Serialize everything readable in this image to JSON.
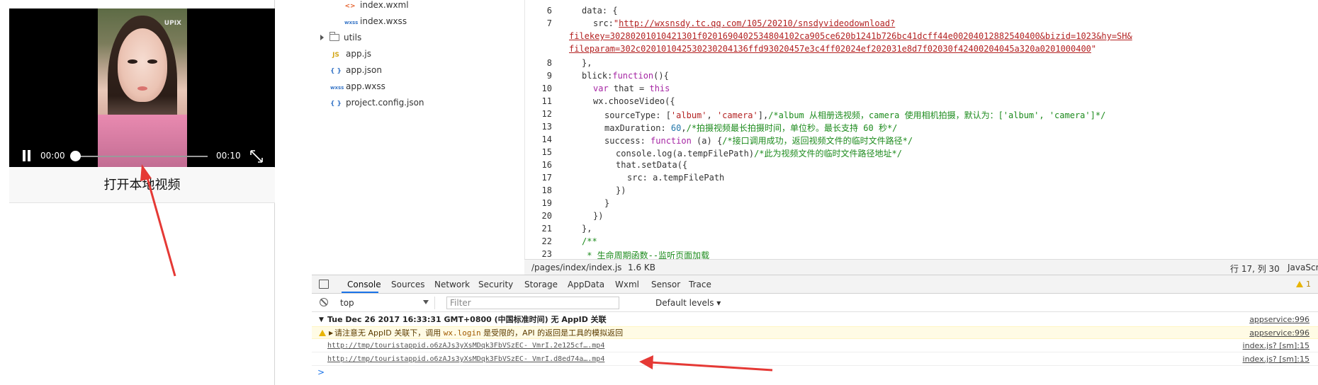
{
  "simulator": {
    "watermark": "UPIX",
    "video": {
      "current_time": "00:00",
      "total_time": "00:10",
      "progress": 0
    },
    "open_button_label": "打开本地视频"
  },
  "file_tree": [
    {
      "icon": "wxml-icon",
      "glyph": "<>",
      "label": "index.wxml"
    },
    {
      "icon": "wxss-icon",
      "glyph": "wxss",
      "label": "index.wxss"
    },
    {
      "icon": "folder-icon",
      "glyph": "",
      "label": "utils"
    },
    {
      "icon": "js-icon",
      "glyph": "JS",
      "label": "app.js"
    },
    {
      "icon": "json-icon",
      "glyph": "{ }",
      "label": "app.json"
    },
    {
      "icon": "wxss-icon",
      "glyph": "wxss",
      "label": "app.wxss"
    },
    {
      "icon": "json-icon",
      "glyph": "{ }",
      "label": "project.config.json"
    }
  ],
  "editor": {
    "line_numbers": [
      "6",
      "7",
      "8",
      "9",
      "10",
      "11",
      "12",
      "13",
      "14",
      "15",
      "16",
      "17",
      "18",
      "19",
      "20",
      "21",
      "22",
      "23"
    ],
    "lines": {
      "l6": "data: {",
      "l7_key": "src:",
      "l7_url1": "http://wxsnsdy.tc.qq.com/105/20210/snsdyvideodownload?",
      "l7_url2": "filekey=30280201010421301f0201690402534804102ca905ce620b1241b726bc41dcff44e00204012882540400&bizid=1023&hy=SH&",
      "l7_url3": "fileparam=302c020101042530230204136ffd93020457e3c4ff02024ef202031e8d7f02030f42400204045a320a0201000400",
      "l8": "},",
      "l9_name": "blick:",
      "l9_kw": "function",
      "l9_rest": "(){",
      "l10_kw": "var",
      "l10_name": " that = ",
      "l10_this": "this",
      "l11": "wx.chooseVideo({",
      "l12_a": "sourceType: [",
      "l12_b": "'album'",
      "l12_c": ", ",
      "l12_d": "'camera'",
      "l12_e": "],",
      "l12_cmt": "/*album 从相册选视频，camera 使用相机拍摄，默认为：['album', 'camera']*/",
      "l13_a": "maxDuration: ",
      "l13_num": "60",
      "l13_b": ",",
      "l13_cmt": "/*拍摄视频最长拍摄时间，单位秒。最长支持 60 秒*/",
      "l14_a": "success: ",
      "l14_kw": "function",
      "l14_b": " (a) {",
      "l14_cmt": "/*接口调用成功，返回视频文件的临时文件路径*/",
      "l15_a": "console.log(a.tempFilePath)",
      "l15_cmt": "/*此为视频文件的临时文件路径地址*/",
      "l16": "that.setData({",
      "l17": "src: a.tempFilePath",
      "l18": "})",
      "l19": "}",
      "l20": "})",
      "l21": "},",
      "l22": "/**",
      "l23": " * 生命周期函数--监听页面加载"
    },
    "status": {
      "path": "/pages/index/index.js",
      "size": "1.6 KB",
      "cursor": "行 17, 列 30",
      "lang": "JavaScript"
    }
  },
  "console": {
    "tabs": [
      "Console",
      "Sources",
      "Network",
      "Security",
      "Storage",
      "AppData",
      "Wxml",
      "Sensor",
      "Trace"
    ],
    "active_tab": "Console",
    "warning_count": "1",
    "context": "top",
    "filter_placeholder": "Filter",
    "levels": "Default levels",
    "messages": {
      "group": "Tue Dec 26 2017 16:33:31 GMT+0800 (中国标准时间) 无 AppID 关联",
      "group_src": "appservice:996",
      "warn_a": "请注意无 AppID 关联下，调用 ",
      "warn_code": "wx.login",
      "warn_b": " 是受限的，API 的返回是工具的模拟返回",
      "warn_src": "appservice:996",
      "link1": "http://tmp/touristappid.o6zAJs3yXsMDqk3FbVSzEC- VmrI.2e125cf….mp4",
      "link1_src": "index.js? [sm]:15",
      "link2": "http://tmp/touristappid.o6zAJs3yXsMDqk3FbVSzEC- VmrI.d8ed74a….mp4",
      "link2_src": "index.js? [sm]:15"
    },
    "prompt": ">"
  },
  "colors": {
    "annotation_arrow": "#e53935",
    "tab_accent": "#1a73e8",
    "warning": "#e8b400"
  }
}
